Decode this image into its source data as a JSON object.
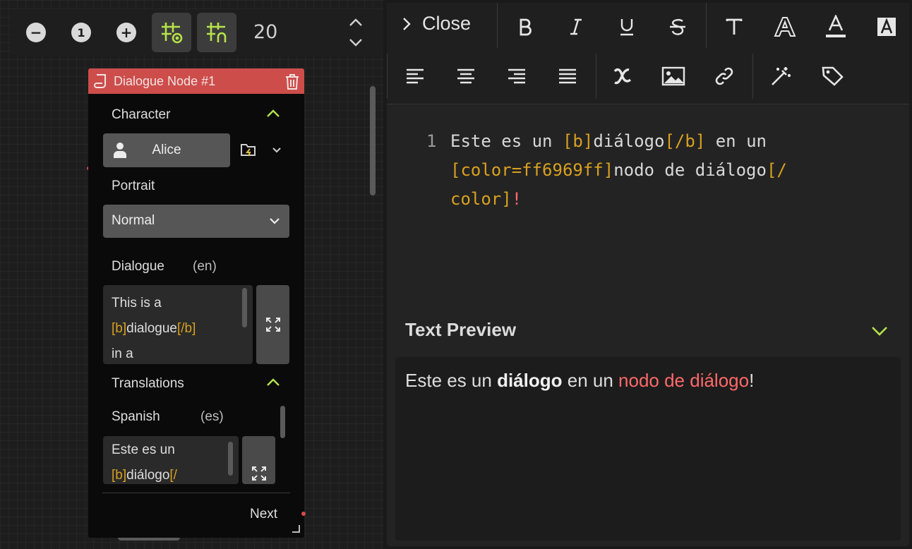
{
  "zoom": {
    "out_label": "−",
    "reset_label": "1",
    "in_label": "+",
    "value": "20"
  },
  "node": {
    "title": "Dialogue Node #1",
    "character_label": "Character",
    "character_name": "Alice",
    "portrait_label": "Portrait",
    "portrait_value": "Normal",
    "dialogue_label": "Dialogue",
    "dialogue_lang": "(en)",
    "dialogue_text": {
      "l1": "This is a",
      "l2_tag_open": "[b]",
      "l2_word": "dialogue",
      "l2_tag_close": "[/b]",
      "l3": "in a"
    },
    "translations_label": "Translations",
    "spanish_label": "Spanish",
    "spanish_lang": "(es)",
    "spanish_text": {
      "l1": "Este es un",
      "l2_tag_open": "[b]",
      "l2_word": "diálogo",
      "l2_tag_close": "[/"
    },
    "next_label": "Next"
  },
  "editor": {
    "close_label": "Close",
    "code": {
      "line_number": "1",
      "p1": "Este es un ",
      "t1": "[b]",
      "p2": "diálogo",
      "t2": "[/b]",
      "p3": " en un",
      "t3": "[color=ff6969ff]",
      "p4": "nodo de diálogo",
      "t4": "[/",
      "t5": "color]",
      "p5": "!"
    },
    "preview_title": "Text Preview",
    "preview": {
      "p1": "Este es un ",
      "bold": "diálogo",
      "p2": " en un ",
      "red": "nodo de diálogo",
      "p3": "!"
    }
  },
  "colors": {
    "node_header": "#cd4d4a",
    "accent_green": "#b6e34a",
    "tag_orange": "#d9a020",
    "preview_red": "#ff6969"
  }
}
